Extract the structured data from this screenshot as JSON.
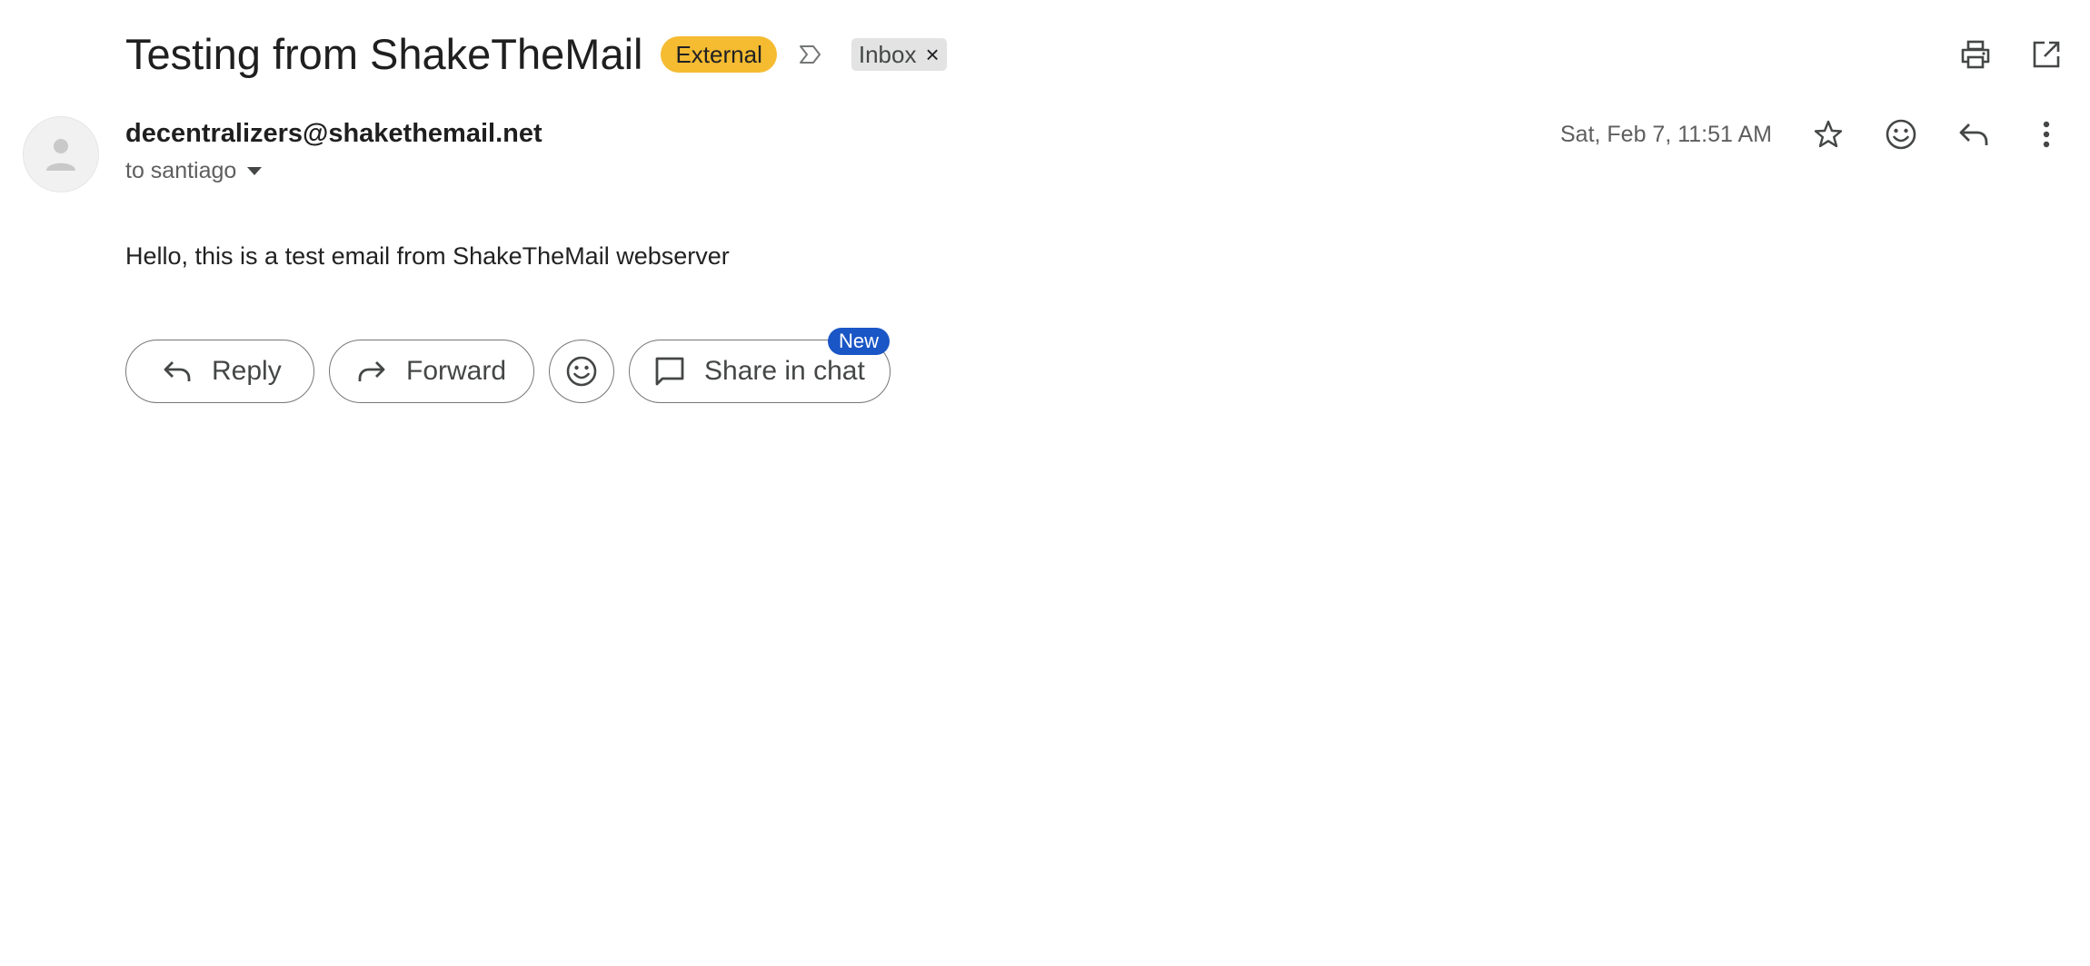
{
  "email": {
    "subject": "Testing from ShakeTheMail",
    "labels": {
      "external": "External",
      "inbox": "Inbox",
      "remove_glyph": "×"
    },
    "sender": "decentralizers@shakethemail.net",
    "recipients": "to santiago",
    "date": "Sat, Feb 7, 11:51 AM",
    "body": "Hello, this is a test email from ShakeTheMail webserver"
  },
  "actions": {
    "reply": "Reply",
    "forward": "Forward",
    "share_in_chat": "Share in chat",
    "new_badge": "New"
  },
  "icons": {
    "top": [
      "print-icon",
      "open-in-new-window-icon"
    ],
    "header": [
      "star-icon",
      "emoji-reaction-icon",
      "reply-icon",
      "more-vert-icon"
    ]
  },
  "colors": {
    "external_label": "#f5bb31",
    "inbox_label": "#e3e3e3",
    "new_badge": "#1a56c6"
  }
}
